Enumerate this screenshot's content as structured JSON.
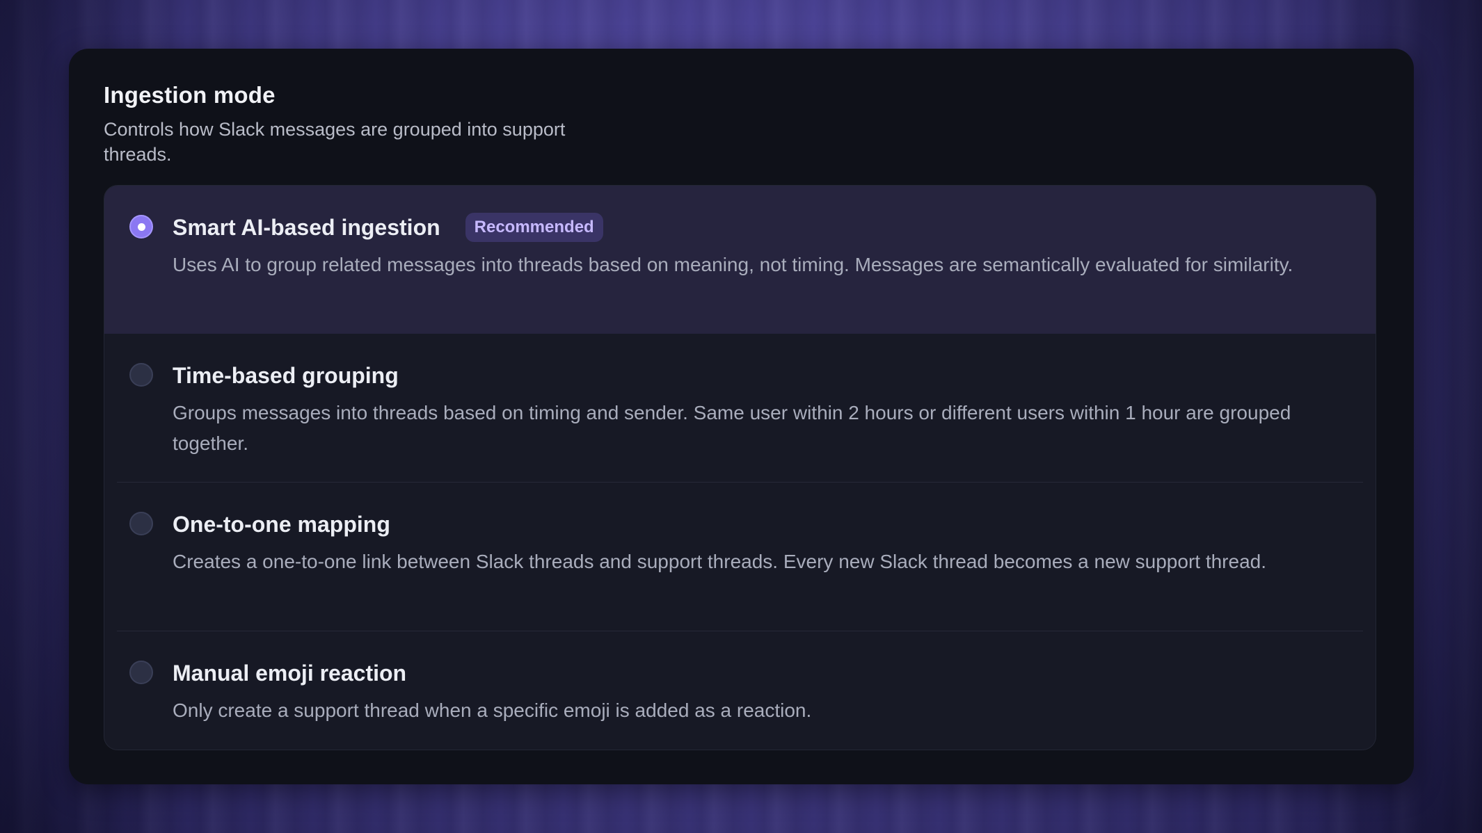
{
  "section": {
    "title": "Ingestion mode",
    "description": "Controls how Slack messages are grouped into support threads."
  },
  "options": [
    {
      "title": "Smart AI-based ingestion",
      "badge": "Recommended",
      "description": "Uses AI to group related messages into threads based on meaning, not timing. Messages are semantically evaluated for similarity.",
      "selected": true
    },
    {
      "title": "Time-based grouping",
      "description": "Groups messages into threads based on timing and sender. Same user within 2 hours or different users within 1 hour are grouped together.",
      "selected": false
    },
    {
      "title": "One-to-one mapping",
      "description": "Creates a one-to-one link between Slack threads and support threads. Every new Slack thread becomes a new support thread.",
      "selected": false
    },
    {
      "title": "Manual emoji reaction",
      "description": "Only create a support thread when a specific emoji is added as a reaction.",
      "selected": false
    }
  ],
  "colors": {
    "accent": "#8b78f2",
    "badge_bg": "#3a3466",
    "badge_text": "#c7b9ff",
    "panel_bg": "#0f1119",
    "selected_row_bg": "#26243e"
  }
}
